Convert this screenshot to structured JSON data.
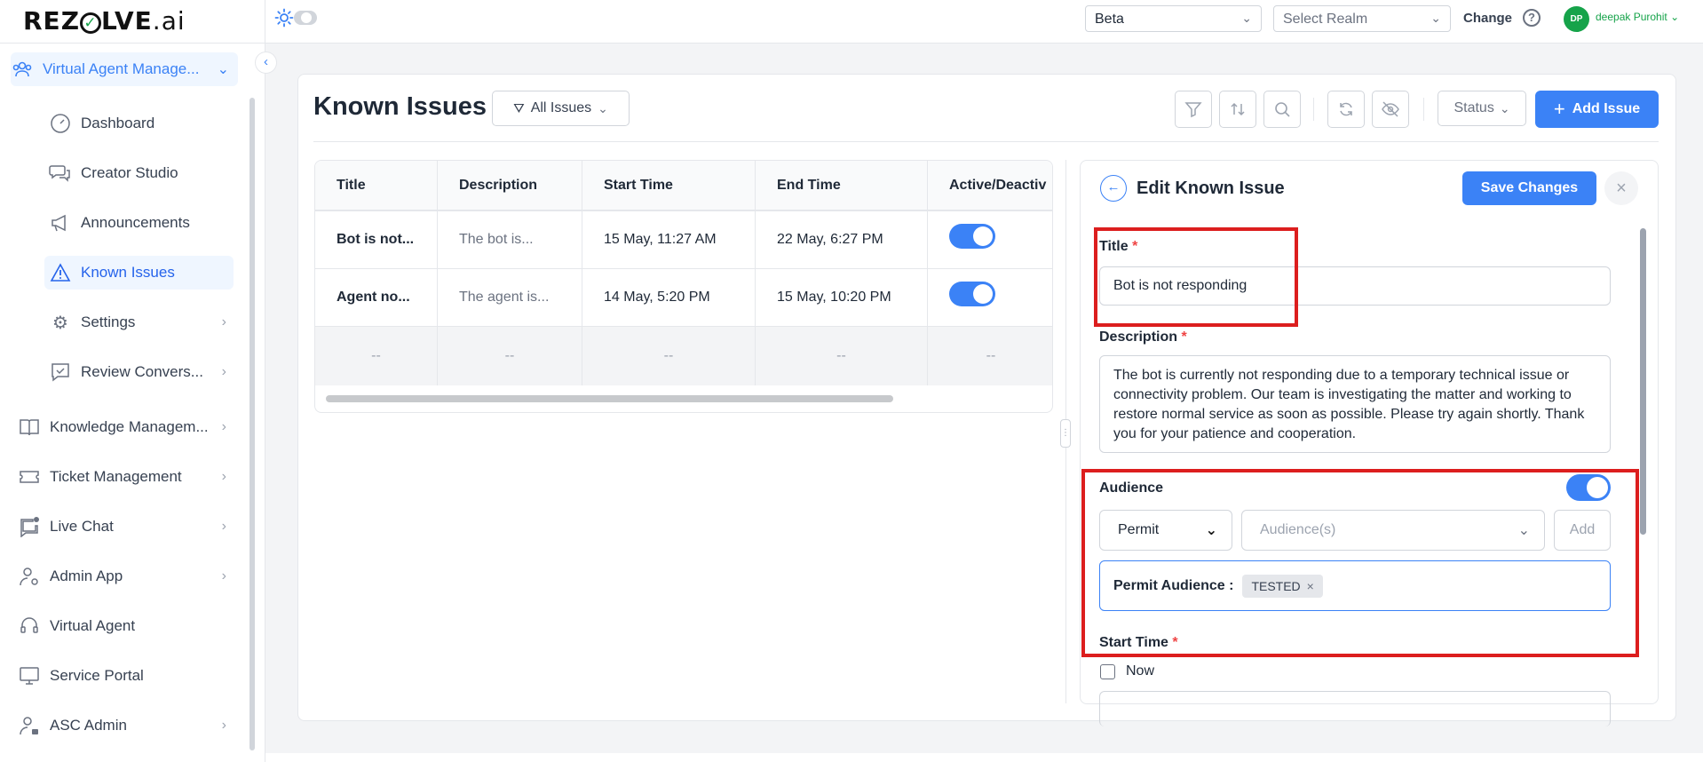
{
  "header": {
    "logo_main": "REZ",
    "logo_o": "✓",
    "logo_rest": "LVE",
    "logo_ai": ".ai",
    "env_select": "Beta",
    "realm_select": "Select Realm",
    "change_label": "Change",
    "avatar_initials": "DP",
    "user_name": "deepak Purohit"
  },
  "sidebar": {
    "parent": "Virtual Agent Manage...",
    "children": [
      "Dashboard",
      "Creator Studio",
      "Announcements",
      "Known Issues",
      "Settings",
      "Review Convers..."
    ],
    "items": [
      "Knowledge Managem...",
      "Ticket Management",
      "Live Chat",
      "Admin App",
      "Virtual Agent",
      "Service Portal",
      "ASC Admin"
    ]
  },
  "page": {
    "title": "Known Issues",
    "filter_label": "All Issues",
    "status_label": "Status",
    "add_label": "Add Issue"
  },
  "table": {
    "columns": [
      "Title",
      "Description",
      "Start Time",
      "End Time",
      "Active/Deactiv"
    ],
    "rows": [
      {
        "title": "Bot is not...",
        "description": "The bot is...",
        "start": "15 May, 11:27 AM",
        "end": "22 May, 6:27 PM",
        "active": true
      },
      {
        "title": "Agent no...",
        "description": "The agent is...",
        "start": "14 May, 5:20 PM",
        "end": "15 May, 10:20 PM",
        "active": true
      }
    ],
    "empty_placeholder": "--"
  },
  "edit": {
    "heading": "Edit Known Issue",
    "save_label": "Save Changes",
    "title_label": "Title",
    "title_value": "Bot is not responding",
    "desc_label": "Description",
    "desc_value": "The bot is currently not responding due to a temporary technical issue or connectivity problem. Our team is investigating the matter and working to restore normal service as soon as possible. Please try again shortly. Thank you for your patience and cooperation.",
    "audience_label": "Audience",
    "audience_enabled": true,
    "permit_select": "Permit",
    "audiences_placeholder": "Audience(s)",
    "add_label": "Add",
    "permit_audience_label": "Permit Audience :",
    "chip_label": "TESTED",
    "start_time_label": "Start Time",
    "now_label": "Now",
    "required_mark": "*"
  },
  "colors": {
    "accent": "#3b82f6",
    "annotation": "#dc1e1e",
    "avatar": "#16a34a"
  }
}
